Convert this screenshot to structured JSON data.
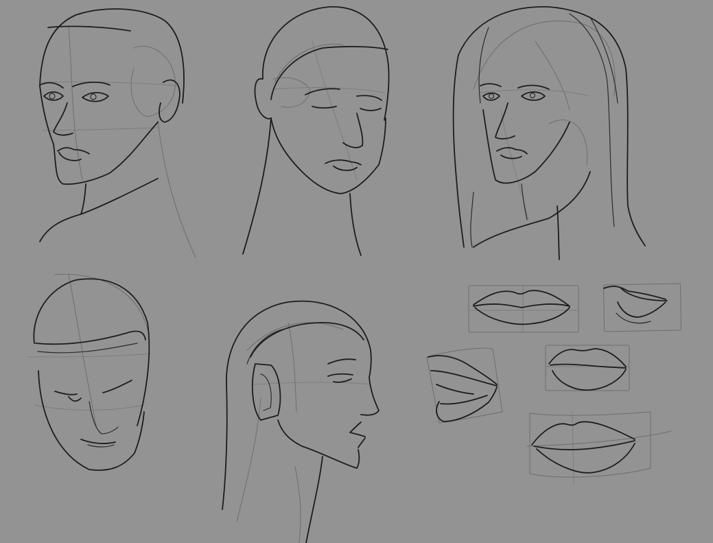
{
  "canvas": {
    "background": "#939393",
    "ink_color": "#1c1c1c",
    "guide_color": "#6d6d6d"
  },
  "sketches": [
    {
      "name": "head-three-quarter-left"
    },
    {
      "name": "head-three-quarter-eyes-closed"
    },
    {
      "name": "head-long-hair"
    },
    {
      "name": "head-tilted-down"
    },
    {
      "name": "head-profile-right"
    },
    {
      "name": "lips-study-front"
    },
    {
      "name": "lips-study-side"
    },
    {
      "name": "lips-study-open-mouth"
    },
    {
      "name": "lips-study-three-quarter"
    },
    {
      "name": "lips-study-front-large"
    }
  ]
}
